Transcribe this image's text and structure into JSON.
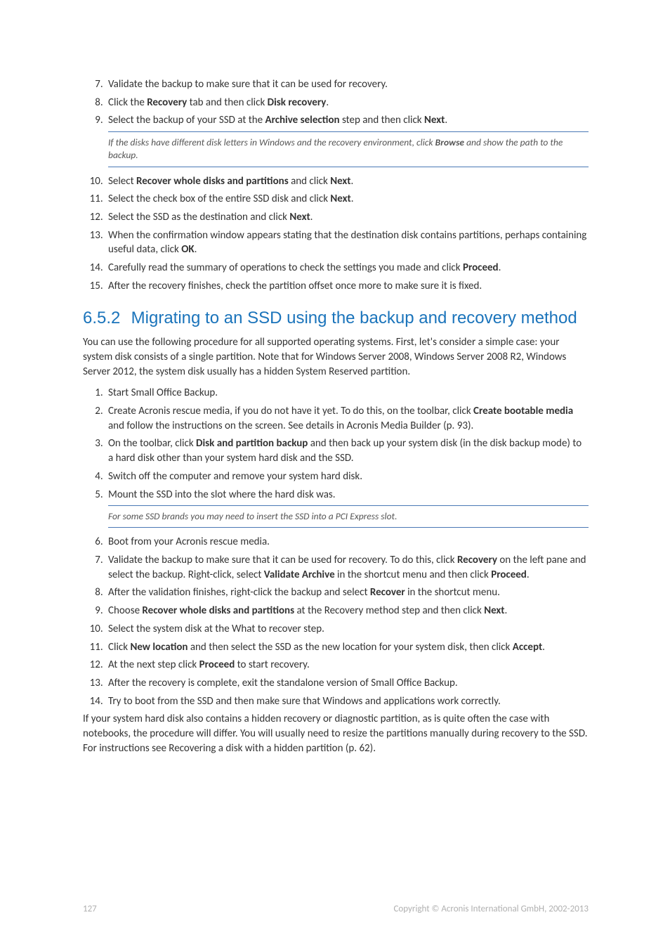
{
  "list1": {
    "i7": {
      "n": "7.",
      "t1": "Validate the backup to make sure that it can be used for recovery."
    },
    "i8": {
      "n": "8.",
      "t1": "Click the ",
      "b1": "Recovery",
      "t2": " tab and then click ",
      "b2": "Disk recovery",
      "t3": "."
    },
    "i9": {
      "n": "9.",
      "t1": "Select the backup of your SSD at the ",
      "b1": "Archive selection",
      "t2": " step and then click ",
      "b2": "Next",
      "t3": "."
    },
    "note1": {
      "t1": "If the disks have different disk letters in Windows and the recovery environment, click ",
      "b1": "Browse",
      "t2": " and show the path to the backup."
    },
    "i10": {
      "n": "10.",
      "t1": "Select ",
      "b1": "Recover whole disks and partitions",
      "t2": " and click ",
      "b2": "Next",
      "t3": "."
    },
    "i11": {
      "n": "11.",
      "t1": "Select the check box of the entire SSD disk and click ",
      "b1": "Next",
      "t2": "."
    },
    "i12": {
      "n": "12.",
      "t1": "Select the SSD as the destination and click ",
      "b1": "Next",
      "t2": "."
    },
    "i13": {
      "n": "13.",
      "t1": "When the confirmation window appears stating that the destination disk contains partitions, perhaps containing useful data, click ",
      "b1": "OK",
      "t2": "."
    },
    "i14": {
      "n": "14.",
      "t1": "Carefully read the summary of operations to check the settings you made and click ",
      "b1": "Proceed",
      "t2": "."
    },
    "i15": {
      "n": "15.",
      "t1": "After the recovery finishes, check the partition offset once more to make sure it is fixed."
    }
  },
  "heading": {
    "num": "6.5.2",
    "title": "Migrating to an SSD using the backup and recovery method"
  },
  "intro": "You can use the following procedure for all supported operating systems. First, let's consider a simple case: your system disk consists of a single partition. Note that for Windows Server 2008, Windows Server 2008 R2, Windows Server 2012, the system disk usually has a hidden System Reserved partition.",
  "list2": {
    "i1": {
      "n": "1.",
      "t1": "Start Small Office Backup."
    },
    "i2": {
      "n": "2.",
      "t1": "Create Acronis rescue media, if you do not have it yet. To do this, on the toolbar, click ",
      "b1": "Create bootable media",
      "t2": " and follow the instructions on the screen. See details in Acronis Media Builder (p. 93)."
    },
    "i3": {
      "n": "3.",
      "t1": "On the toolbar, click ",
      "b1": "Disk and partition backup",
      "t2": " and then back up your system disk (in the disk backup mode) to a hard disk other than your system hard disk and the SSD."
    },
    "i4": {
      "n": "4.",
      "t1": "Switch off the computer and remove your system hard disk."
    },
    "i5": {
      "n": "5.",
      "t1": "Mount the SSD into the slot where the hard disk was."
    },
    "note2": {
      "t1": "For some SSD brands you may need to insert the SSD into a PCI Express slot."
    },
    "i6": {
      "n": "6.",
      "t1": "Boot from your Acronis rescue media."
    },
    "i7": {
      "n": "7.",
      "t1": "Validate the backup to make sure that it can be used for recovery. To do this, click ",
      "b1": "Recovery",
      "t2": " on the left pane and select the backup. Right-click, select ",
      "b2": "Validate Archive",
      "t3": " in the shortcut menu and then click ",
      "b3": "Proceed",
      "t4": "."
    },
    "i8": {
      "n": "8.",
      "t1": "After the validation finishes, right-click the backup and select ",
      "b1": "Recover",
      "t2": " in the shortcut menu."
    },
    "i9": {
      "n": "9.",
      "t1": "Choose ",
      "b1": "Recover whole disks and partitions",
      "t2": " at the Recovery method step and then click ",
      "b2": "Next",
      "t3": "."
    },
    "i10": {
      "n": "10.",
      "t1": "Select the system disk at the What to recover step."
    },
    "i11": {
      "n": "11.",
      "t1": "Click ",
      "b1": "New location",
      "t2": " and then select the SSD as the new location for your system disk, then click ",
      "b2": "Accept",
      "t3": "."
    },
    "i12": {
      "n": "12.",
      "t1": "At the next step click ",
      "b1": "Proceed",
      "t2": " to start recovery."
    },
    "i13": {
      "n": "13.",
      "t1": "After the recovery is complete, exit the standalone version of Small Office Backup."
    },
    "i14": {
      "n": "14.",
      "t1": "Try to boot from the SSD and then make sure that Windows and applications work correctly."
    }
  },
  "outro": "If your system hard disk also contains a hidden recovery or diagnostic partition, as is quite often the case with notebooks, the procedure will differ. You will usually need to resize the partitions manually during recovery to the SSD. For instructions see Recovering a disk with a hidden partition (p. 62).",
  "footer": {
    "page": "127",
    "copyright": "Copyright © Acronis International GmbH, 2002-2013"
  }
}
